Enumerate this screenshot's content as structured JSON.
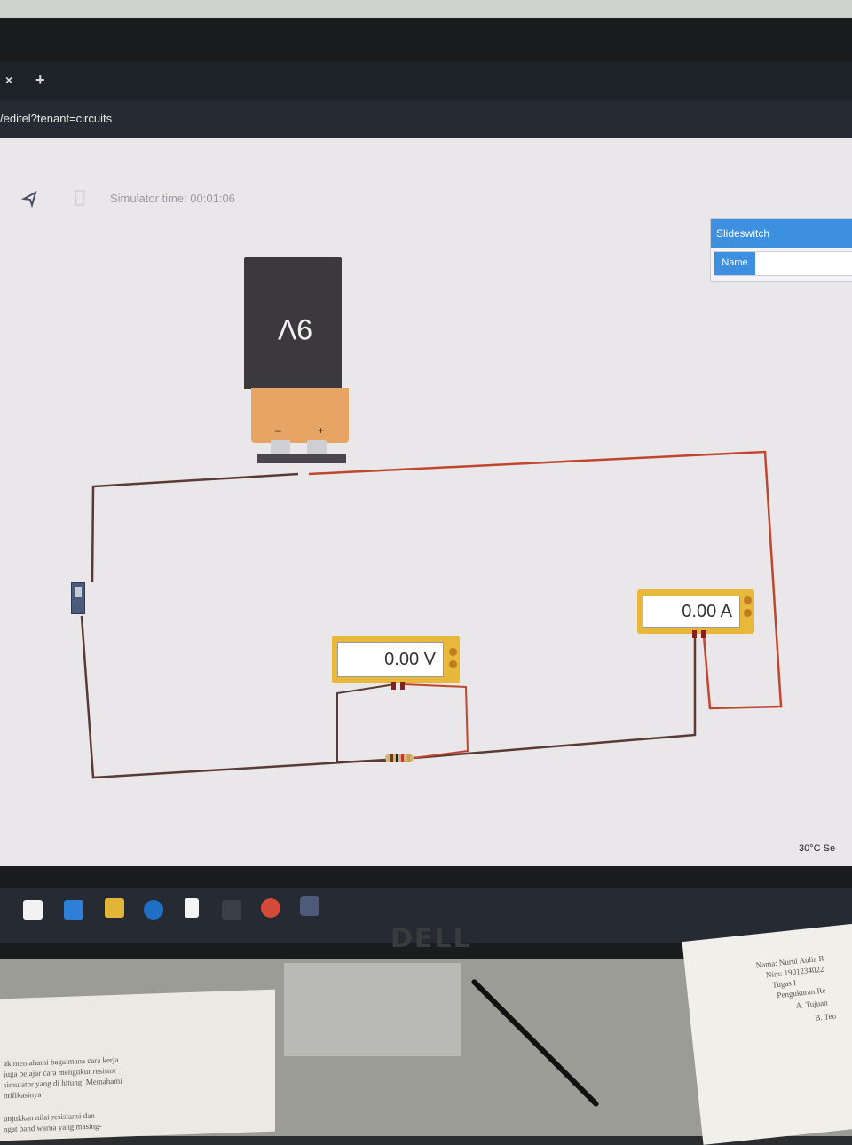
{
  "browser": {
    "tab_close": "×",
    "tab_new": "+",
    "url": "/editel?tenant=circuits"
  },
  "toolbar": {
    "simulator_time_label": "Simulator time: 00:01:06"
  },
  "inspector": {
    "title": "Slideswitch",
    "name_label": "Name",
    "name_value": ""
  },
  "circuit": {
    "battery": {
      "label": "9V",
      "minus": "–",
      "plus": "+"
    },
    "voltmeter": {
      "reading": "0.00 V"
    },
    "ammeter": {
      "reading": "0.00 A"
    }
  },
  "taskbar": {
    "weather": "30°C Se"
  },
  "monitor": {
    "brand": "DELL"
  },
  "papers": {
    "right_lines": [
      "Nama: Nurul Aulia R",
      "Nim: 1901234022",
      "Tugas I",
      "Pengukuran Re",
      "A. Tujuan",
      "B. Teo"
    ],
    "left_lines": [
      "ak memahami bagaimana cara kerja",
      "juga belajar cara mengukur resistor",
      "simulator yang di hitung. Memahami",
      "ntifikasinya",
      "unjukkan nilai resistansi dan",
      "ngat band warna yang masing-"
    ]
  },
  "colors": {
    "inspector_blue": "#3d8fe0",
    "meter_yellow": "#e8b83a",
    "battery_orange": "#e6a564",
    "wire_red": "#c0392b",
    "wire_dark": "#4a3a3a"
  }
}
